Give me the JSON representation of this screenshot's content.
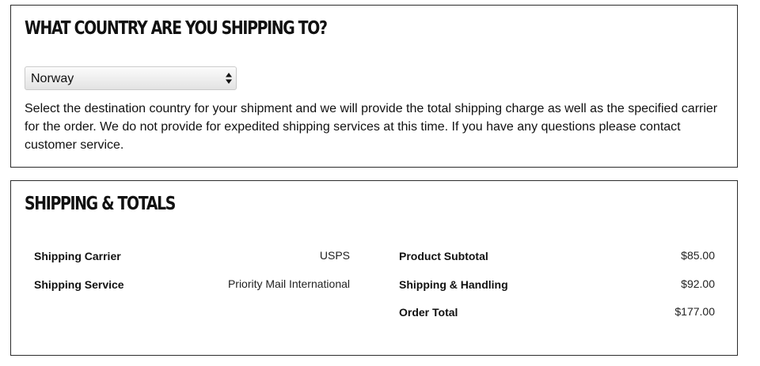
{
  "country_section": {
    "heading": "WHAT COUNTRY ARE YOU SHIPPING TO?",
    "select": {
      "selected": "Norway"
    },
    "description": "Select the destination country for your shipment and we will provide the total shipping charge as well as the specified carrier for the order. We do not provide for expedited shipping services at this time. If you have any questions please contact customer service."
  },
  "totals_section": {
    "heading": "SHIPPING & TOTALS",
    "shipping": [
      {
        "label": "Shipping Carrier",
        "value": "USPS"
      },
      {
        "label": "Shipping Service",
        "value": "Priority Mail International"
      }
    ],
    "totals": [
      {
        "label": "Product Subtotal",
        "value": "$85.00"
      },
      {
        "label": "Shipping & Handling",
        "value": "$92.00"
      },
      {
        "label": "Order Total",
        "value": "$177.00"
      }
    ]
  },
  "icons": {
    "select_arrows": "up-down-arrows-icon"
  }
}
